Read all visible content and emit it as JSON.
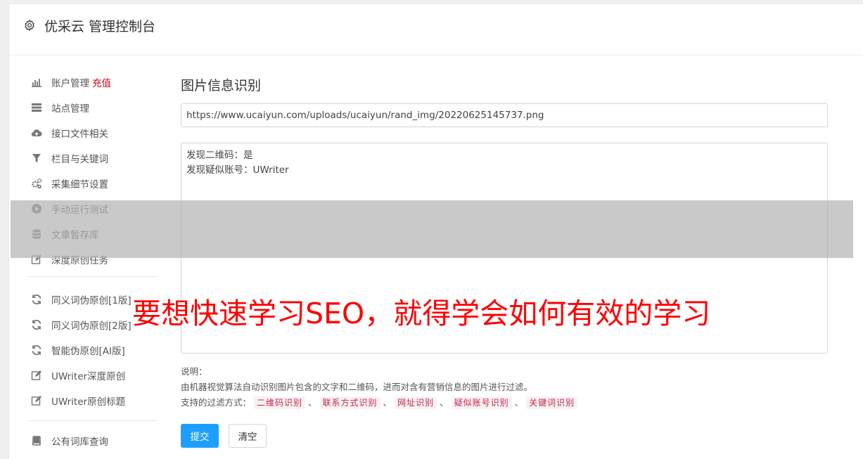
{
  "header": {
    "title": "优采云 管理控制台"
  },
  "sidebar": {
    "items": [
      {
        "label": "账户管理",
        "extra": "充值",
        "icon": "bar-chart-icon"
      },
      {
        "label": "站点管理",
        "icon": "server-icon"
      },
      {
        "label": "接口文件相关",
        "icon": "cloud-upload-icon"
      },
      {
        "label": "栏目与关键词",
        "icon": "filter-icon"
      },
      {
        "label": "采集细节设置",
        "icon": "gears-icon"
      },
      {
        "label": "手动运行测试",
        "icon": "play-circle-icon"
      },
      {
        "label": "文章暂存库",
        "icon": "database-icon"
      },
      {
        "label": "深度原创任务",
        "icon": "edit-icon"
      },
      {
        "label": "同义词伪原创[1版]",
        "icon": "refresh-icon"
      },
      {
        "label": "同义词伪原创[2版]",
        "icon": "refresh-icon"
      },
      {
        "label": "智能伪原创[AI版]",
        "icon": "refresh-icon"
      },
      {
        "label": "UWriter深度原创",
        "icon": "edit-icon"
      },
      {
        "label": "UWriter原创标题",
        "icon": "edit-icon"
      },
      {
        "label": "公有词库查询",
        "icon": "book-icon"
      }
    ]
  },
  "main": {
    "title": "图片信息识别",
    "url_value": "https://www.ucaiyun.com/uploads/ucaiyun/rand_img/20220625145737.png",
    "result_lines": [
      "发现二维码：是",
      "发现疑似账号：UWriter"
    ],
    "notes": {
      "label": "说明：",
      "description": "由机器视觉算法自动识别图片包含的文字和二维码，进而对含有营销信息的图片进行过滤。",
      "filters_label": "支持的过滤方式：",
      "filters": [
        "二维码识别",
        "联系方式识别",
        "网址识别",
        "疑似账号识别",
        "关键词识别"
      ],
      "separator": "、"
    },
    "buttons": {
      "submit": "提交",
      "clear": "清空"
    }
  },
  "overlay": {
    "caption": "要想快速学习SEO，就得学会如何有效的学习"
  },
  "colors": {
    "accent": "#1e9fff",
    "recharge": "#d9001b",
    "caption": "#ff0000",
    "tag_text": "#c7254e",
    "tag_bg": "#f9f2f4"
  }
}
